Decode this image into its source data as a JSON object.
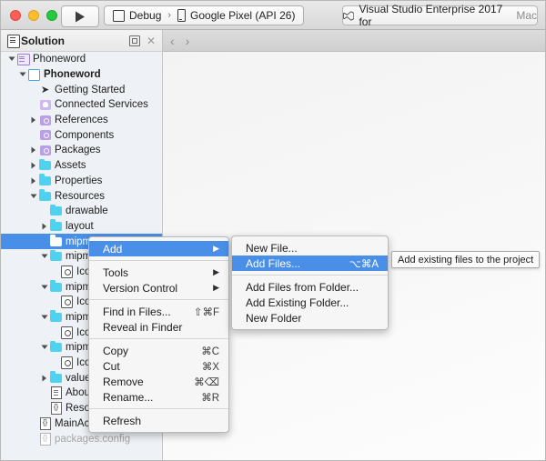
{
  "titlebar": {
    "run_config": {
      "configuration": "Debug",
      "separator": "›",
      "device": "Google Pixel (API 26)"
    },
    "app_title_main": "Visual Studio Enterprise 2017 for",
    "app_title_suffix": "Mac"
  },
  "solution_panel": {
    "title": "Solution",
    "pin_tooltip": "Pin",
    "close_label": "✕",
    "nav_back": "‹",
    "nav_forward": "›"
  },
  "tree": [
    {
      "label": "Phoneword",
      "indent": 0,
      "twisty": "down",
      "icon": "solution-icon",
      "bold": false,
      "dim": false,
      "selected": false
    },
    {
      "label": "Phoneword",
      "indent": 1,
      "twisty": "down",
      "icon": "project-icon",
      "bold": true,
      "dim": false,
      "selected": false
    },
    {
      "label": "Getting Started",
      "indent": 2,
      "twisty": "none",
      "icon": "rocket-icon",
      "bold": false,
      "dim": false,
      "selected": false
    },
    {
      "label": "Connected Services",
      "indent": 2,
      "twisty": "none",
      "icon": "services-icon",
      "bold": false,
      "dim": false,
      "selected": false
    },
    {
      "label": "References",
      "indent": 2,
      "twisty": "right",
      "icon": "assembly-icon",
      "bold": false,
      "dim": false,
      "selected": false
    },
    {
      "label": "Components",
      "indent": 2,
      "twisty": "none",
      "icon": "assembly-icon",
      "bold": false,
      "dim": false,
      "selected": false
    },
    {
      "label": "Packages",
      "indent": 2,
      "twisty": "right",
      "icon": "assembly-icon",
      "bold": false,
      "dim": false,
      "selected": false
    },
    {
      "label": "Assets",
      "indent": 2,
      "twisty": "right",
      "icon": "folder-icon",
      "bold": false,
      "dim": false,
      "selected": false
    },
    {
      "label": "Properties",
      "indent": 2,
      "twisty": "right",
      "icon": "folder-icon",
      "bold": false,
      "dim": false,
      "selected": false
    },
    {
      "label": "Resources",
      "indent": 2,
      "twisty": "down",
      "icon": "folder-icon",
      "bold": false,
      "dim": false,
      "selected": false
    },
    {
      "label": "drawable",
      "indent": 3,
      "twisty": "none",
      "icon": "folder-icon",
      "bold": false,
      "dim": false,
      "selected": false
    },
    {
      "label": "layout",
      "indent": 3,
      "twisty": "right",
      "icon": "folder-icon",
      "bold": false,
      "dim": false,
      "selected": false
    },
    {
      "label": "mipmap",
      "indent": 3,
      "twisty": "none",
      "icon": "folder-icon",
      "bold": false,
      "dim": false,
      "selected": true
    },
    {
      "label": "mipmap",
      "indent": 3,
      "twisty": "down",
      "icon": "folder-icon",
      "bold": false,
      "dim": false,
      "selected": false
    },
    {
      "label": "Icon.p",
      "indent": 4,
      "twisty": "none",
      "icon": "png-icon",
      "bold": false,
      "dim": false,
      "selected": false
    },
    {
      "label": "mipmap",
      "indent": 3,
      "twisty": "down",
      "icon": "folder-icon",
      "bold": false,
      "dim": false,
      "selected": false
    },
    {
      "label": "Icon.p",
      "indent": 4,
      "twisty": "none",
      "icon": "png-icon",
      "bold": false,
      "dim": false,
      "selected": false
    },
    {
      "label": "mipmap",
      "indent": 3,
      "twisty": "down",
      "icon": "folder-icon",
      "bold": false,
      "dim": false,
      "selected": false
    },
    {
      "label": "Icon.p",
      "indent": 4,
      "twisty": "none",
      "icon": "png-icon",
      "bold": false,
      "dim": false,
      "selected": false
    },
    {
      "label": "mipmap",
      "indent": 3,
      "twisty": "down",
      "icon": "folder-icon",
      "bold": false,
      "dim": false,
      "selected": false
    },
    {
      "label": "Icon.p",
      "indent": 4,
      "twisty": "none",
      "icon": "png-icon",
      "bold": false,
      "dim": false,
      "selected": false
    },
    {
      "label": "values",
      "indent": 3,
      "twisty": "right",
      "icon": "folder-icon",
      "bold": false,
      "dim": false,
      "selected": false
    },
    {
      "label": "AboutR",
      "indent": 3,
      "twisty": "none",
      "icon": "doc-icon",
      "bold": false,
      "dim": false,
      "selected": false
    },
    {
      "label": "Resourc",
      "indent": 3,
      "twisty": "none",
      "icon": "braces-icon",
      "bold": false,
      "dim": false,
      "selected": false
    },
    {
      "label": "MainActivity.cs",
      "indent": 2,
      "twisty": "none",
      "icon": "braces-icon",
      "bold": false,
      "dim": false,
      "selected": false
    },
    {
      "label": "packages.config",
      "indent": 2,
      "twisty": "none",
      "icon": "braces-dim-icon",
      "bold": false,
      "dim": true,
      "selected": false
    }
  ],
  "context_menu": [
    {
      "label": "Add",
      "shortcut": "",
      "submenu": true,
      "highlighted": true,
      "separator_after": true
    },
    {
      "label": "Tools",
      "shortcut": "",
      "submenu": true,
      "highlighted": false,
      "separator_after": false
    },
    {
      "label": "Version Control",
      "shortcut": "",
      "submenu": true,
      "highlighted": false,
      "separator_after": true
    },
    {
      "label": "Find in Files...",
      "shortcut": "⇧⌘F",
      "submenu": false,
      "highlighted": false,
      "separator_after": false
    },
    {
      "label": "Reveal in Finder",
      "shortcut": "",
      "submenu": false,
      "highlighted": false,
      "separator_after": true
    },
    {
      "label": "Copy",
      "shortcut": "⌘C",
      "submenu": false,
      "highlighted": false,
      "separator_after": false
    },
    {
      "label": "Cut",
      "shortcut": "⌘X",
      "submenu": false,
      "highlighted": false,
      "separator_after": false
    },
    {
      "label": "Remove",
      "shortcut": "⌘⌫",
      "submenu": false,
      "highlighted": false,
      "separator_after": false
    },
    {
      "label": "Rename...",
      "shortcut": "⌘R",
      "submenu": false,
      "highlighted": false,
      "separator_after": true
    },
    {
      "label": "Refresh",
      "shortcut": "",
      "submenu": false,
      "highlighted": false,
      "separator_after": false
    }
  ],
  "submenu": [
    {
      "label": "New File...",
      "shortcut": "",
      "highlighted": false,
      "separator_after": false
    },
    {
      "label": "Add Files...",
      "shortcut": "⌥⌘A",
      "highlighted": true,
      "separator_after": true
    },
    {
      "label": "Add Files from Folder...",
      "shortcut": "",
      "highlighted": false,
      "separator_after": false
    },
    {
      "label": "Add Existing Folder...",
      "shortcut": "",
      "highlighted": false,
      "separator_after": false
    },
    {
      "label": "New Folder",
      "shortcut": "",
      "highlighted": false,
      "separator_after": false
    }
  ],
  "tooltip": {
    "text": "Add existing files to the project"
  },
  "colors": {
    "selection_blue": "#4a8fe7",
    "folder_cyan": "#4fd2f0",
    "accent_purple": "#b9a0e6"
  }
}
